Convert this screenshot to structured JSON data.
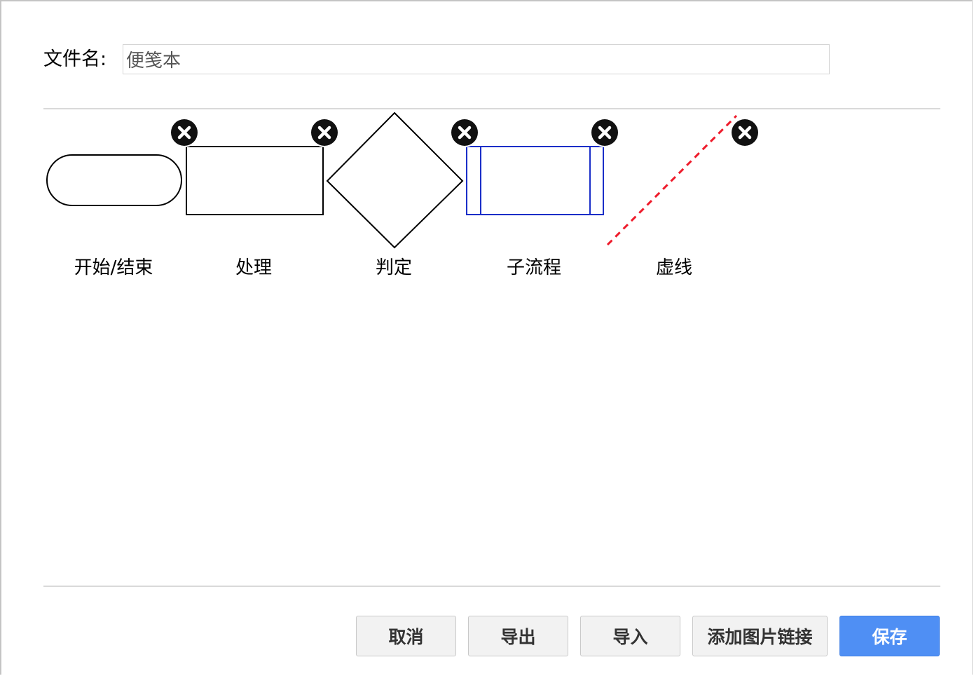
{
  "file": {
    "label": "文件名:",
    "value": "便笺本"
  },
  "shapes": [
    {
      "label": "开始/结束"
    },
    {
      "label": "处理"
    },
    {
      "label": "判定"
    },
    {
      "label": "子流程"
    },
    {
      "label": "虚线"
    }
  ],
  "buttons": {
    "cancel": "取消",
    "export": "导出",
    "import": "导入",
    "add_image_link": "添加图片链接",
    "save": "保存"
  },
  "colors": {
    "subprocess_stroke": "#1a2ec8",
    "dashed_line": "#ee1b2b",
    "primary_button": "#4f8ff4"
  },
  "icons": {
    "delete": "close-circle-icon"
  }
}
